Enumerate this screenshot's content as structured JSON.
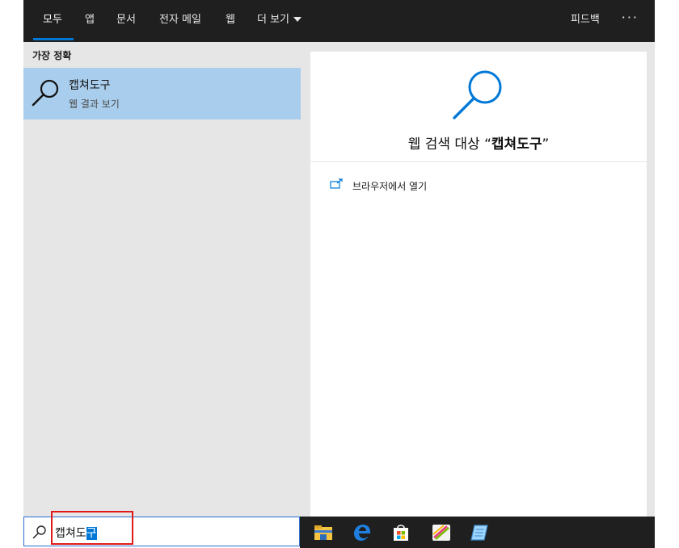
{
  "nav": {
    "tabs": [
      {
        "label": "모두",
        "active": true
      },
      {
        "label": "앱"
      },
      {
        "label": "문서"
      },
      {
        "label": "전자 메일"
      },
      {
        "label": "웹"
      },
      {
        "label": "더 보기"
      }
    ],
    "feedback": "피드백",
    "more_icon": "ellipsis-icon"
  },
  "best_match": {
    "heading": "가장 정확",
    "item": {
      "title": "캡쳐도구",
      "subtitle": "웹 결과 보기",
      "icon": "search-icon"
    }
  },
  "preview": {
    "title_prefix": "웹 검색 대상 “",
    "query": "캡쳐도구",
    "title_suffix": "”",
    "actions": [
      {
        "label": "브라우저에서 열기",
        "icon": "open-external-icon"
      }
    ]
  },
  "search": {
    "value_unselected": "캡쳐도",
    "value_selected": "구"
  },
  "taskbar": {
    "icons": [
      "file-explorer-icon",
      "edge-icon",
      "store-icon",
      "paint-app-icon",
      "notepad-app-icon"
    ]
  },
  "colors": {
    "accent": "#0078d7",
    "selected_item": "#a9cdec",
    "panel_bg": "#e6e6e6",
    "topbar_bg": "#1f1f1f",
    "highlight_border": "#e01a1a"
  }
}
